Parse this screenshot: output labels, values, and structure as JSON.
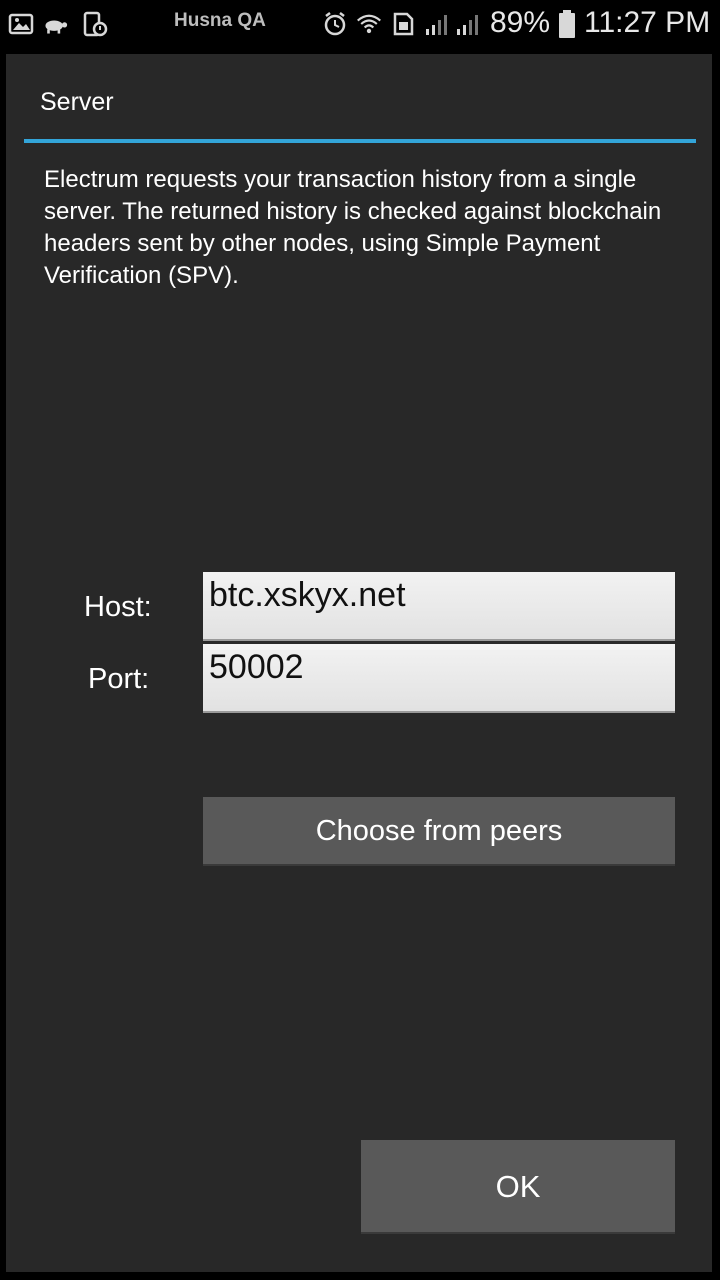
{
  "status_bar": {
    "carrier": "Husna QA",
    "battery_percent": "89%",
    "time": "11:27 PM",
    "icons": [
      "gallery-icon",
      "turtle-icon",
      "phone-lock-icon",
      "alarm-icon",
      "wifi-icon",
      "sim-icon",
      "signal-icon",
      "signal-icon-2",
      "battery-icon"
    ]
  },
  "dialog": {
    "title": "Server",
    "description": "Electrum requests your transaction history from a single server. The returned history is checked against blockchain headers sent by other nodes, using Simple Payment Verification (SPV).",
    "host_label": "Host:",
    "host_value": "btc.xskyx.net",
    "port_label": "Port:",
    "port_value": "50002",
    "choose_peers_label": "Choose from peers",
    "ok_label": "OK"
  },
  "colors": {
    "accent": "#33a5d9",
    "dialog_bg": "#282828",
    "button_bg": "#595959"
  }
}
